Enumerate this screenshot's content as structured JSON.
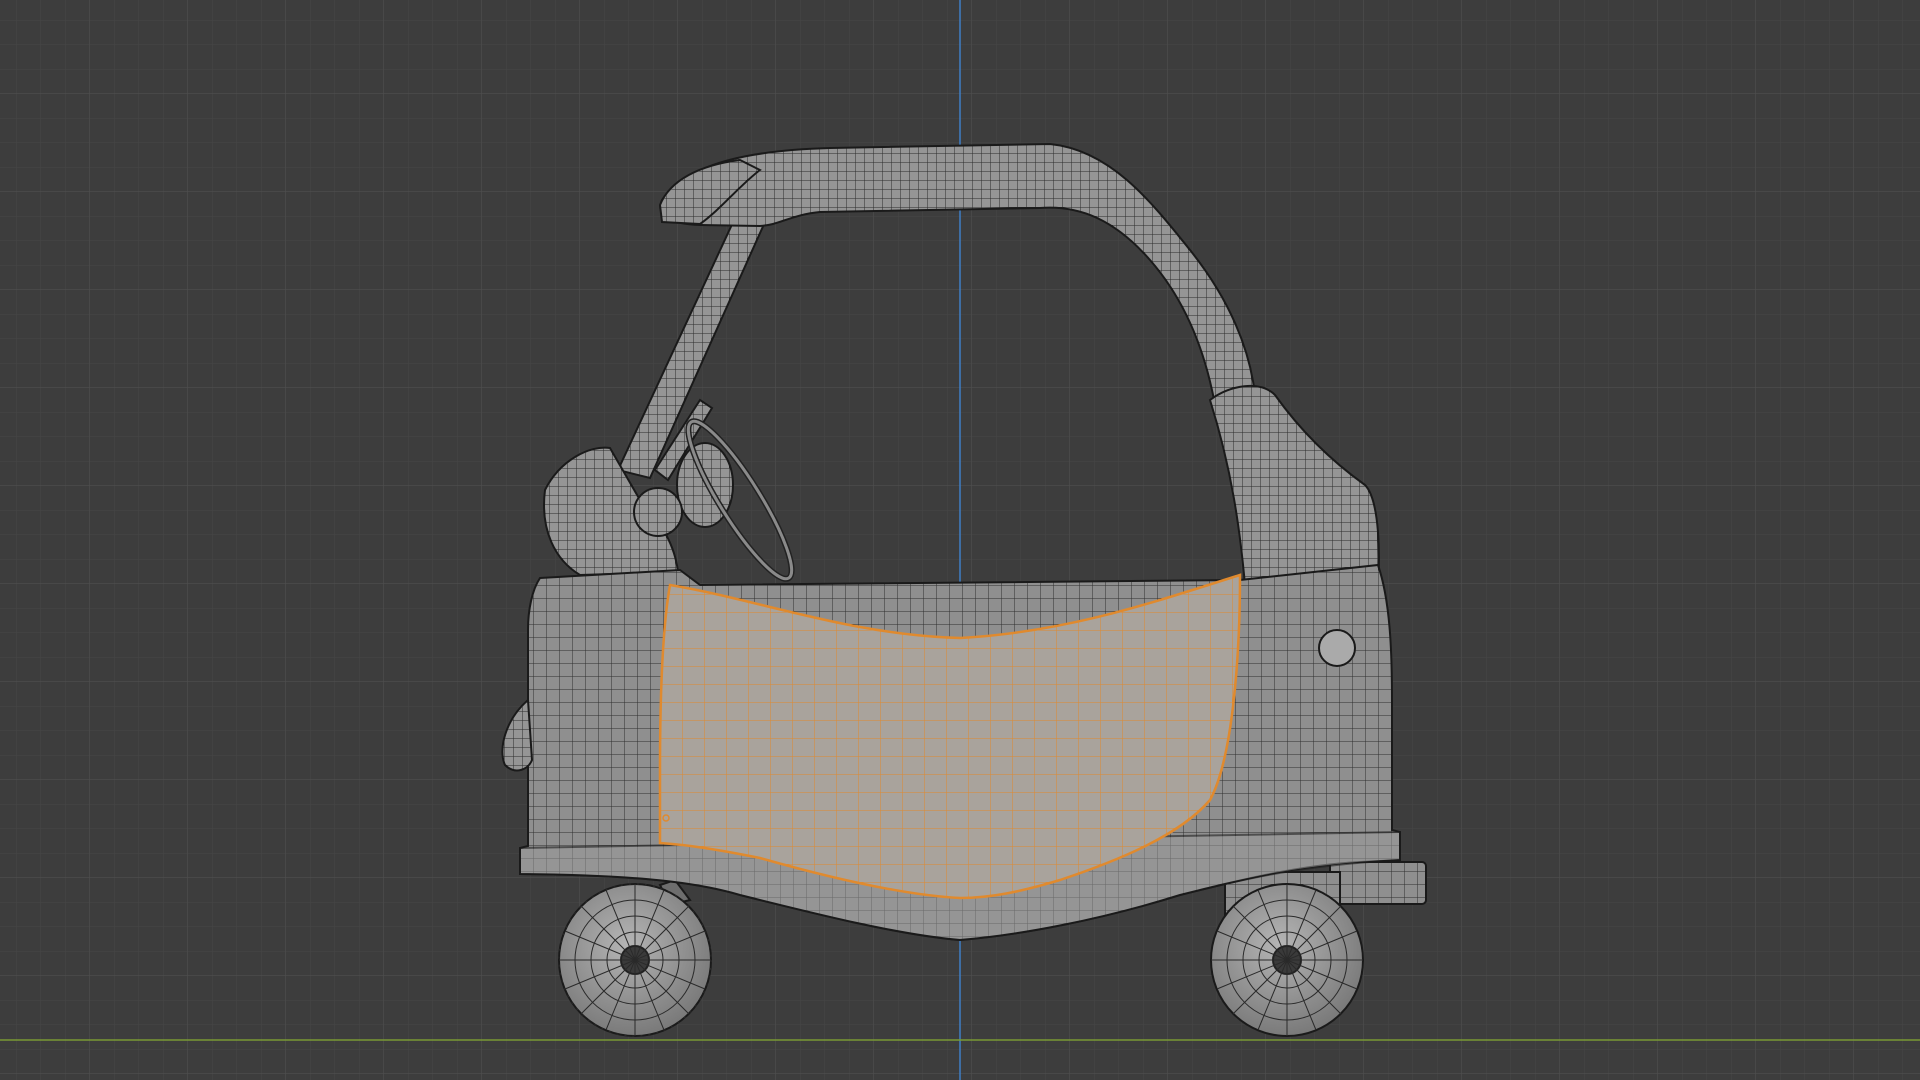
{
  "viewport": {
    "view": "wireframe-side-view",
    "colors": {
      "background": "#3d3d3d",
      "grid_minor": "#474747",
      "grid_major": "#505050",
      "axis_vertical": "#3f7fc7",
      "axis_horizontal": "#7a9a35",
      "mesh_fill": "#8b8b8b",
      "mesh_fill_light": "#a3a3a3",
      "mesh_wire": "#2f2f2f",
      "mesh_outline": "#1a1a1a",
      "selected_wire": "#e08a2e",
      "selected_fill": "#a9a39c"
    }
  },
  "scene": {
    "object": "ride-on-toy-car",
    "parts": [
      "roof",
      "front-pillar",
      "rear-pillar",
      "body",
      "hood",
      "steering-wheel",
      "door",
      "front-wheel",
      "rear-wheel",
      "rear-bumper",
      "fuel-cap"
    ],
    "selected_part": "door"
  }
}
